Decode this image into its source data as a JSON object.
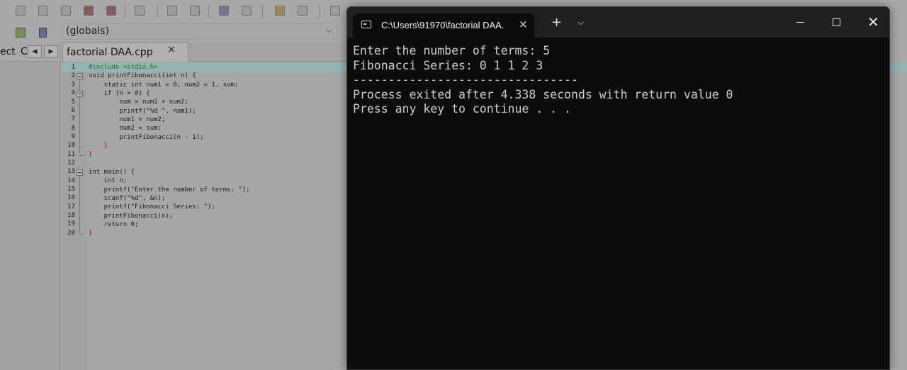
{
  "ide": {
    "scope_dropdown": {
      "value": "(globals)"
    },
    "left_panel": {
      "tab1": "ect",
      "tab2": "C",
      "prev_arrow": "◀",
      "next_arrow": "▶"
    },
    "editor": {
      "file_tab": {
        "label": "factorial DAA.cpp",
        "close": "×"
      },
      "line_numbers": [
        "1",
        "2",
        "3",
        "4",
        "5",
        "6",
        "7",
        "8",
        "9",
        "10",
        "11",
        "12",
        "13",
        "14",
        "15",
        "16",
        "17",
        "18",
        "19",
        "20"
      ],
      "code_lines": [
        "#include <stdio.h>",
        "void printFibonacci(int n) {",
        "    static int num1 = 0, num2 = 1, sum;",
        "    if (n > 0) {",
        "        sum = num1 + num2;",
        "        printf(\"%d \", num1);",
        "        num1 = num2;",
        "        num2 = sum;",
        "        printFibonacci(n - 1);",
        "    }",
        "}",
        "",
        "int main() {",
        "    int n;",
        "    printf(\"Enter the number of terms: \");",
        "    scanf(\"%d\", &n);",
        "    printf(\"Fibonacci Series: \");",
        "    printFibonacci(n);",
        "    return 0;",
        "}"
      ]
    }
  },
  "terminal": {
    "tab_title": "C:\\Users\\91970\\factorial DAA.",
    "tab_close": "×",
    "new_tab": "+",
    "dropdown": "⌵",
    "close": "✕",
    "output_lines": [
      "Enter the number of terms: 5",
      "Fibonacci Series: 0 1 1 2 3",
      "--------------------------------",
      "Process exited after 4.338 seconds with return value 0",
      "Press any key to continue . . ."
    ]
  }
}
